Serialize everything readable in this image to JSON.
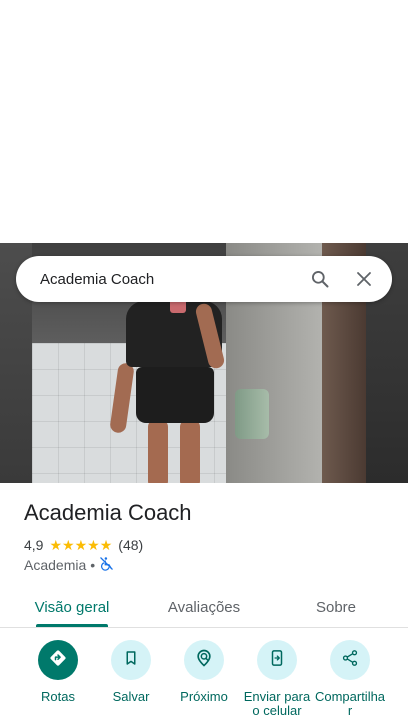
{
  "search": {
    "query": "Academia Coach"
  },
  "place": {
    "name": "Academia Coach",
    "rating": "4,9",
    "stars": 5,
    "review_count": "(48)",
    "category": "Academia",
    "separator": "•"
  },
  "tabs": [
    {
      "label": "Visão geral",
      "active": true
    },
    {
      "label": "Avaliações",
      "active": false
    },
    {
      "label": "Sobre",
      "active": false
    }
  ],
  "actions": [
    {
      "label": "Rotas",
      "icon": "directions-icon"
    },
    {
      "label": "Salvar",
      "icon": "bookmark-icon"
    },
    {
      "label": "Próximo",
      "icon": "nearby-icon"
    },
    {
      "label": "Enviar para o celular",
      "icon": "send-to-phone-icon"
    },
    {
      "label": "Compartilhar",
      "icon": "share-icon"
    }
  ],
  "colors": {
    "accent": "#00796b",
    "action_bg": "#d5f3f7",
    "star": "#fbbc04",
    "wheelchair_icon": "#1a73e8"
  }
}
